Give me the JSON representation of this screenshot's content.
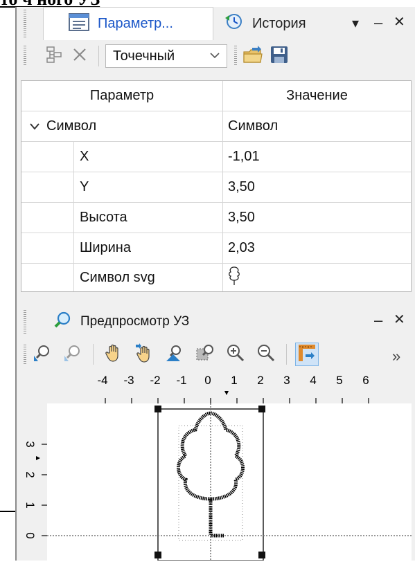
{
  "document": {
    "heading_fragment": "то ч ного УЗ"
  },
  "panel": {
    "tabs": [
      {
        "label": "Параметр...",
        "icon": "properties-icon",
        "active": true
      },
      {
        "label": "История",
        "icon": "history-icon",
        "active": false
      }
    ],
    "menu_glyph": "▾",
    "minimize_glyph": "–",
    "close_glyph": "✕"
  },
  "toolbar": {
    "type_select": {
      "value": "Точечный",
      "chevron": "⌵"
    },
    "icons": [
      "tree-structure-icon",
      "delete-icon",
      "import-icon",
      "save-icon"
    ]
  },
  "grid": {
    "headers": {
      "param": "Параметр",
      "value": "Значение"
    },
    "group": {
      "expander": "⌄",
      "name": "Символ",
      "value": "Символ"
    },
    "rows": [
      {
        "name": "X",
        "value": "-1,01"
      },
      {
        "name": "Y",
        "value": "3,50"
      },
      {
        "name": "Высота",
        "value": "3,50"
      },
      {
        "name": "Ширина",
        "value": "2,03"
      },
      {
        "name": "Символ svg",
        "value": ""
      }
    ]
  },
  "preview": {
    "title": "Предпросмотр УЗ",
    "overflow": "»",
    "ruler_x": [
      "-4",
      "-3",
      "-2",
      "-1",
      "0",
      "1",
      "2",
      "3",
      "4",
      "5",
      "6"
    ],
    "ruler_y": [
      "3",
      "2",
      "1",
      "0"
    ],
    "tools": [
      "zoom-all-icon",
      "zoom-previous-icon",
      "pan-hand-icon",
      "pan-realtime-icon",
      "zoom-window-icon",
      "zoom-extent-icon",
      "zoom-in-icon",
      "zoom-out-icon",
      "ruler-toggle-icon"
    ],
    "accent": "#1a56c8",
    "active_tool_bg": "#cfe3f7"
  }
}
